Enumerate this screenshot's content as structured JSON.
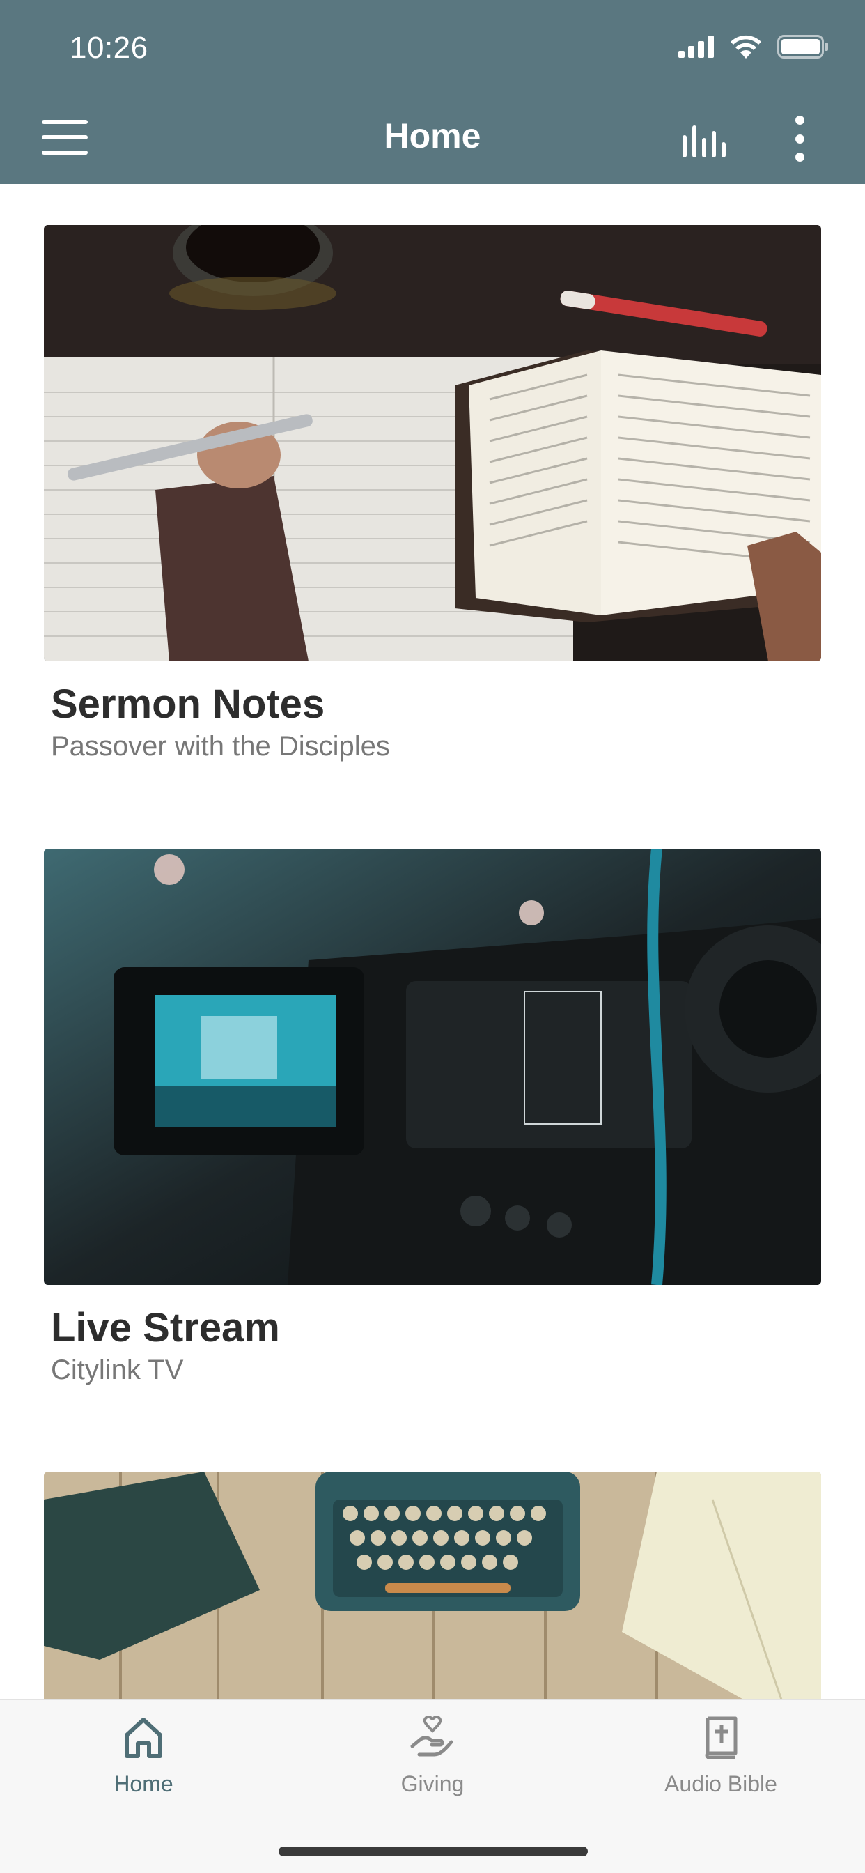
{
  "status_bar": {
    "time": "10:26"
  },
  "nav": {
    "title": "Home"
  },
  "cards": [
    {
      "title": "Sermon Notes",
      "subtitle": "Passover with the Disciples",
      "image": "notebook-bible-photo"
    },
    {
      "title": "Live Stream",
      "subtitle": "Citylink TV",
      "image": "video-camera-photo"
    },
    {
      "title": "",
      "subtitle": "",
      "image": "typewriter-desk-photo"
    }
  ],
  "tabs": [
    {
      "label": "Home",
      "icon": "home-icon",
      "active": true
    },
    {
      "label": "Giving",
      "icon": "giving-hand-heart-icon",
      "active": false
    },
    {
      "label": "Audio Bible",
      "icon": "bible-book-icon",
      "active": false
    }
  ],
  "colors": {
    "header": "#5a7780",
    "accent": "#4f6e76",
    "inactive_tab": "#8a8a8a"
  }
}
